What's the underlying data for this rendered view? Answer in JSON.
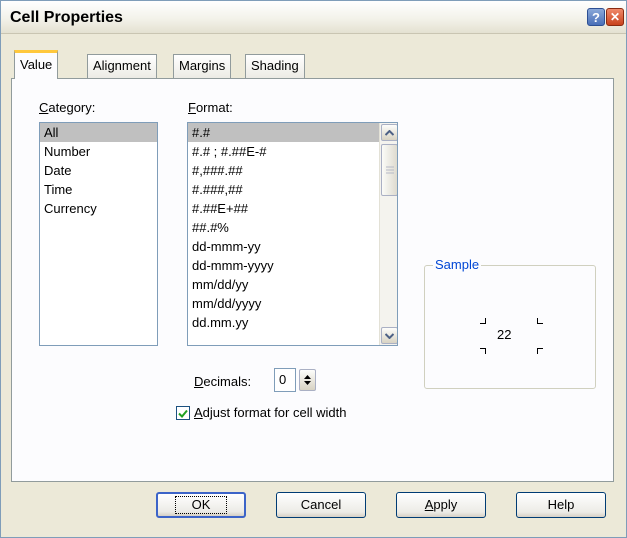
{
  "window": {
    "title": "Cell Properties",
    "help_icon": "help-icon",
    "close_icon": "close-icon"
  },
  "tabs": [
    {
      "label": "Value",
      "active": true
    },
    {
      "label": "Alignment",
      "active": false
    },
    {
      "label": "Margins",
      "active": false
    },
    {
      "label": "Shading",
      "active": false
    }
  ],
  "category": {
    "label_mnemonic": "C",
    "label_rest": "ategory:",
    "items": [
      "All",
      "Number",
      "Date",
      "Time",
      "Currency"
    ],
    "selected": "All"
  },
  "format": {
    "label_mnemonic": "F",
    "label_rest": "ormat:",
    "items": [
      "#.#",
      "#.# ; #.##E-#",
      "#,###.##",
      "#.###,##",
      "#.##E+##",
      "##.#%",
      "dd-mmm-yy",
      "dd-mmm-yyyy",
      "mm/dd/yy",
      "mm/dd/yyyy",
      "dd.mm.yy"
    ],
    "selected": "#.#"
  },
  "decimals": {
    "label_mnemonic": "D",
    "label_rest": "ecimals:",
    "value": "0"
  },
  "adjust_format": {
    "label_mnemonic": "A",
    "label_rest": "djust format for cell width",
    "checked": true
  },
  "sample": {
    "title": "Sample",
    "value": "22"
  },
  "buttons": {
    "ok": "OK",
    "cancel": "Cancel",
    "apply_mnemonic": "A",
    "apply_rest": "pply",
    "help": "Help"
  },
  "colors": {
    "dialog_bg": "#ece9d8",
    "panel_bg": "#fcfcfe",
    "active_tab_accent": "#ffc83c",
    "selection": "#c0c0c0",
    "groupbox_title": "#0046d5"
  }
}
